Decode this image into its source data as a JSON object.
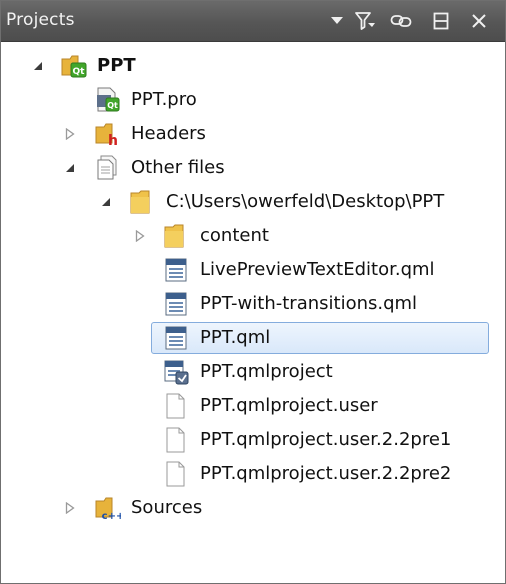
{
  "panel": {
    "title": "Projects"
  },
  "toolbar": {
    "dropdown_icon": "chevron-down-icon",
    "filter_icon": "filter-icon",
    "link_icon": "link-icon",
    "split_icon": "split-icon",
    "close_icon": "close-icon"
  },
  "tree": {
    "project": {
      "label": "PPT",
      "expanded": true
    },
    "pro_file": {
      "label": "PPT.pro"
    },
    "headers": {
      "label": "Headers",
      "expanded": false
    },
    "other_files": {
      "label": "Other files",
      "expanded": true
    },
    "folder_path": {
      "label": "C:\\Users\\owerfeld\\Desktop\\PPT",
      "expanded": true
    },
    "content": {
      "label": "content",
      "expanded": false
    },
    "files": [
      {
        "label": "LivePreviewTextEditor.qml",
        "icon": "qml-file-icon"
      },
      {
        "label": "PPT-with-transitions.qml",
        "icon": "qml-file-icon"
      },
      {
        "label": "PPT.qml",
        "icon": "qml-file-icon",
        "selected": true
      },
      {
        "label": "PPT.qmlproject",
        "icon": "qmlproject-file-icon"
      },
      {
        "label": "PPT.qmlproject.user",
        "icon": "blank-file-icon"
      },
      {
        "label": "PPT.qmlproject.user.2.2pre1",
        "icon": "blank-file-icon"
      },
      {
        "label": "PPT.qmlproject.user.2.2pre2",
        "icon": "blank-file-icon"
      }
    ],
    "sources": {
      "label": "Sources",
      "expanded": false
    }
  },
  "colors": {
    "titlebar": "#565656",
    "selection_border": "#84acdd",
    "selection_fill": "#d9e8fa",
    "folder": "#e8b83a"
  }
}
